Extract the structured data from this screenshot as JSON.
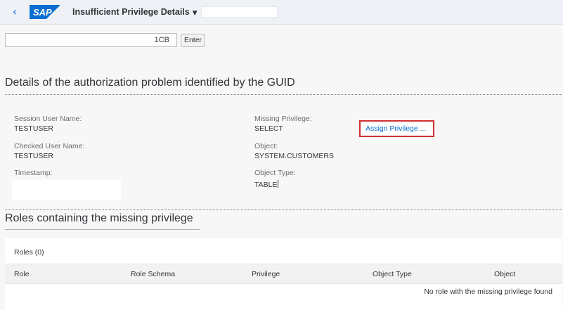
{
  "shell": {
    "app_title": "Insufficient Privilege Details",
    "back_icon": "chevron-left-icon",
    "title_caret_icon": "caret-down-icon",
    "logo_text": "SAP",
    "logo_color": "#0a6ed1"
  },
  "guid": {
    "value": "1CB",
    "enter_label": "Enter"
  },
  "details": {
    "title": "Details of the authorization problem identified by the GUID",
    "session_user_label": "Session User Name:",
    "session_user_value": "TESTUSER",
    "checked_user_label": "Checked User Name:",
    "checked_user_value": "TESTUSER",
    "timestamp_label": "Timestamp:",
    "missing_privilege_label": "Missing Privilege:",
    "missing_privilege_value": "SELECT",
    "object_label": "Object:",
    "object_value": "SYSTEM.CUSTOMERS",
    "object_type_label": "Object Type:",
    "object_type_value": "TABLE",
    "assign_button_label": "Assign Privilege ..."
  },
  "roles": {
    "title": "Roles containing the missing privilege",
    "count_label": "Roles (0)",
    "columns": [
      "Role",
      "Role Schema",
      "Privilege",
      "Object Type",
      "Object"
    ],
    "empty_message": "No role with the missing privilege found"
  },
  "colors": {
    "accent": "#0a6ed1",
    "highlight_border": "#d22f2f"
  }
}
